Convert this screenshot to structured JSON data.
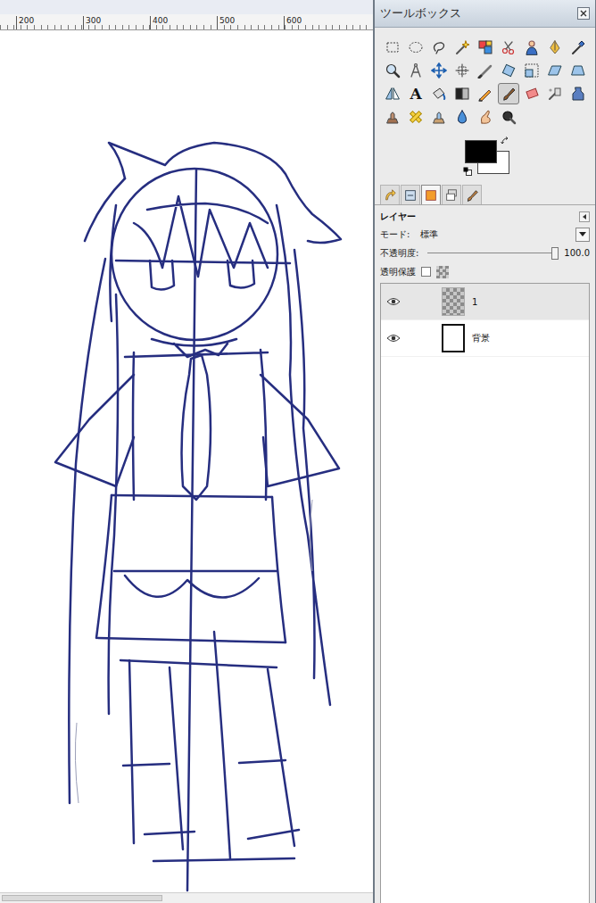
{
  "canvas": {
    "ruler_ticks": [
      "200",
      "300",
      "400",
      "500",
      "600"
    ]
  },
  "toolbox": {
    "title": "ツールボックス",
    "tools": [
      {
        "selected": false
      },
      {
        "selected": false
      },
      {
        "selected": false
      },
      {
        "selected": false
      },
      {
        "selected": false
      },
      {
        "selected": false
      },
      {
        "selected": false
      },
      {
        "selected": false
      },
      {
        "selected": false
      },
      {
        "selected": false
      },
      {
        "selected": false
      },
      {
        "selected": false
      },
      {
        "selected": false
      },
      {
        "selected": false
      },
      {
        "selected": false
      },
      {
        "selected": false
      },
      {
        "selected": false
      },
      {
        "selected": false
      },
      {
        "selected": false
      },
      {
        "selected": false,
        "glyph": "A"
      },
      {
        "selected": false
      },
      {
        "selected": false
      },
      {
        "selected": false
      },
      {
        "selected": true
      },
      {
        "selected": false
      },
      {
        "selected": false
      },
      {
        "selected": false
      },
      {
        "selected": false
      },
      {
        "selected": false
      },
      {
        "selected": false
      },
      {
        "selected": false
      },
      {
        "selected": false
      },
      {
        "selected": false
      }
    ],
    "foreground_color": "#000000",
    "background_color": "#ffffff",
    "dock_tabs": [
      {
        "selected": false
      },
      {
        "selected": false
      },
      {
        "selected": true
      },
      {
        "selected": false
      },
      {
        "selected": false
      }
    ]
  },
  "layers_panel": {
    "title": "レイヤー",
    "mode_label": "モード:",
    "mode_value": "標準",
    "opacity_label": "不透明度:",
    "opacity_value": "100.0",
    "opacity_level": 1,
    "lock_label": "透明保護",
    "lock_checked": false,
    "layers": [
      {
        "name": "1",
        "visible": true,
        "selected": true,
        "kind": "transparent"
      },
      {
        "name": "背景",
        "visible": true,
        "selected": false,
        "kind": "white"
      }
    ]
  }
}
